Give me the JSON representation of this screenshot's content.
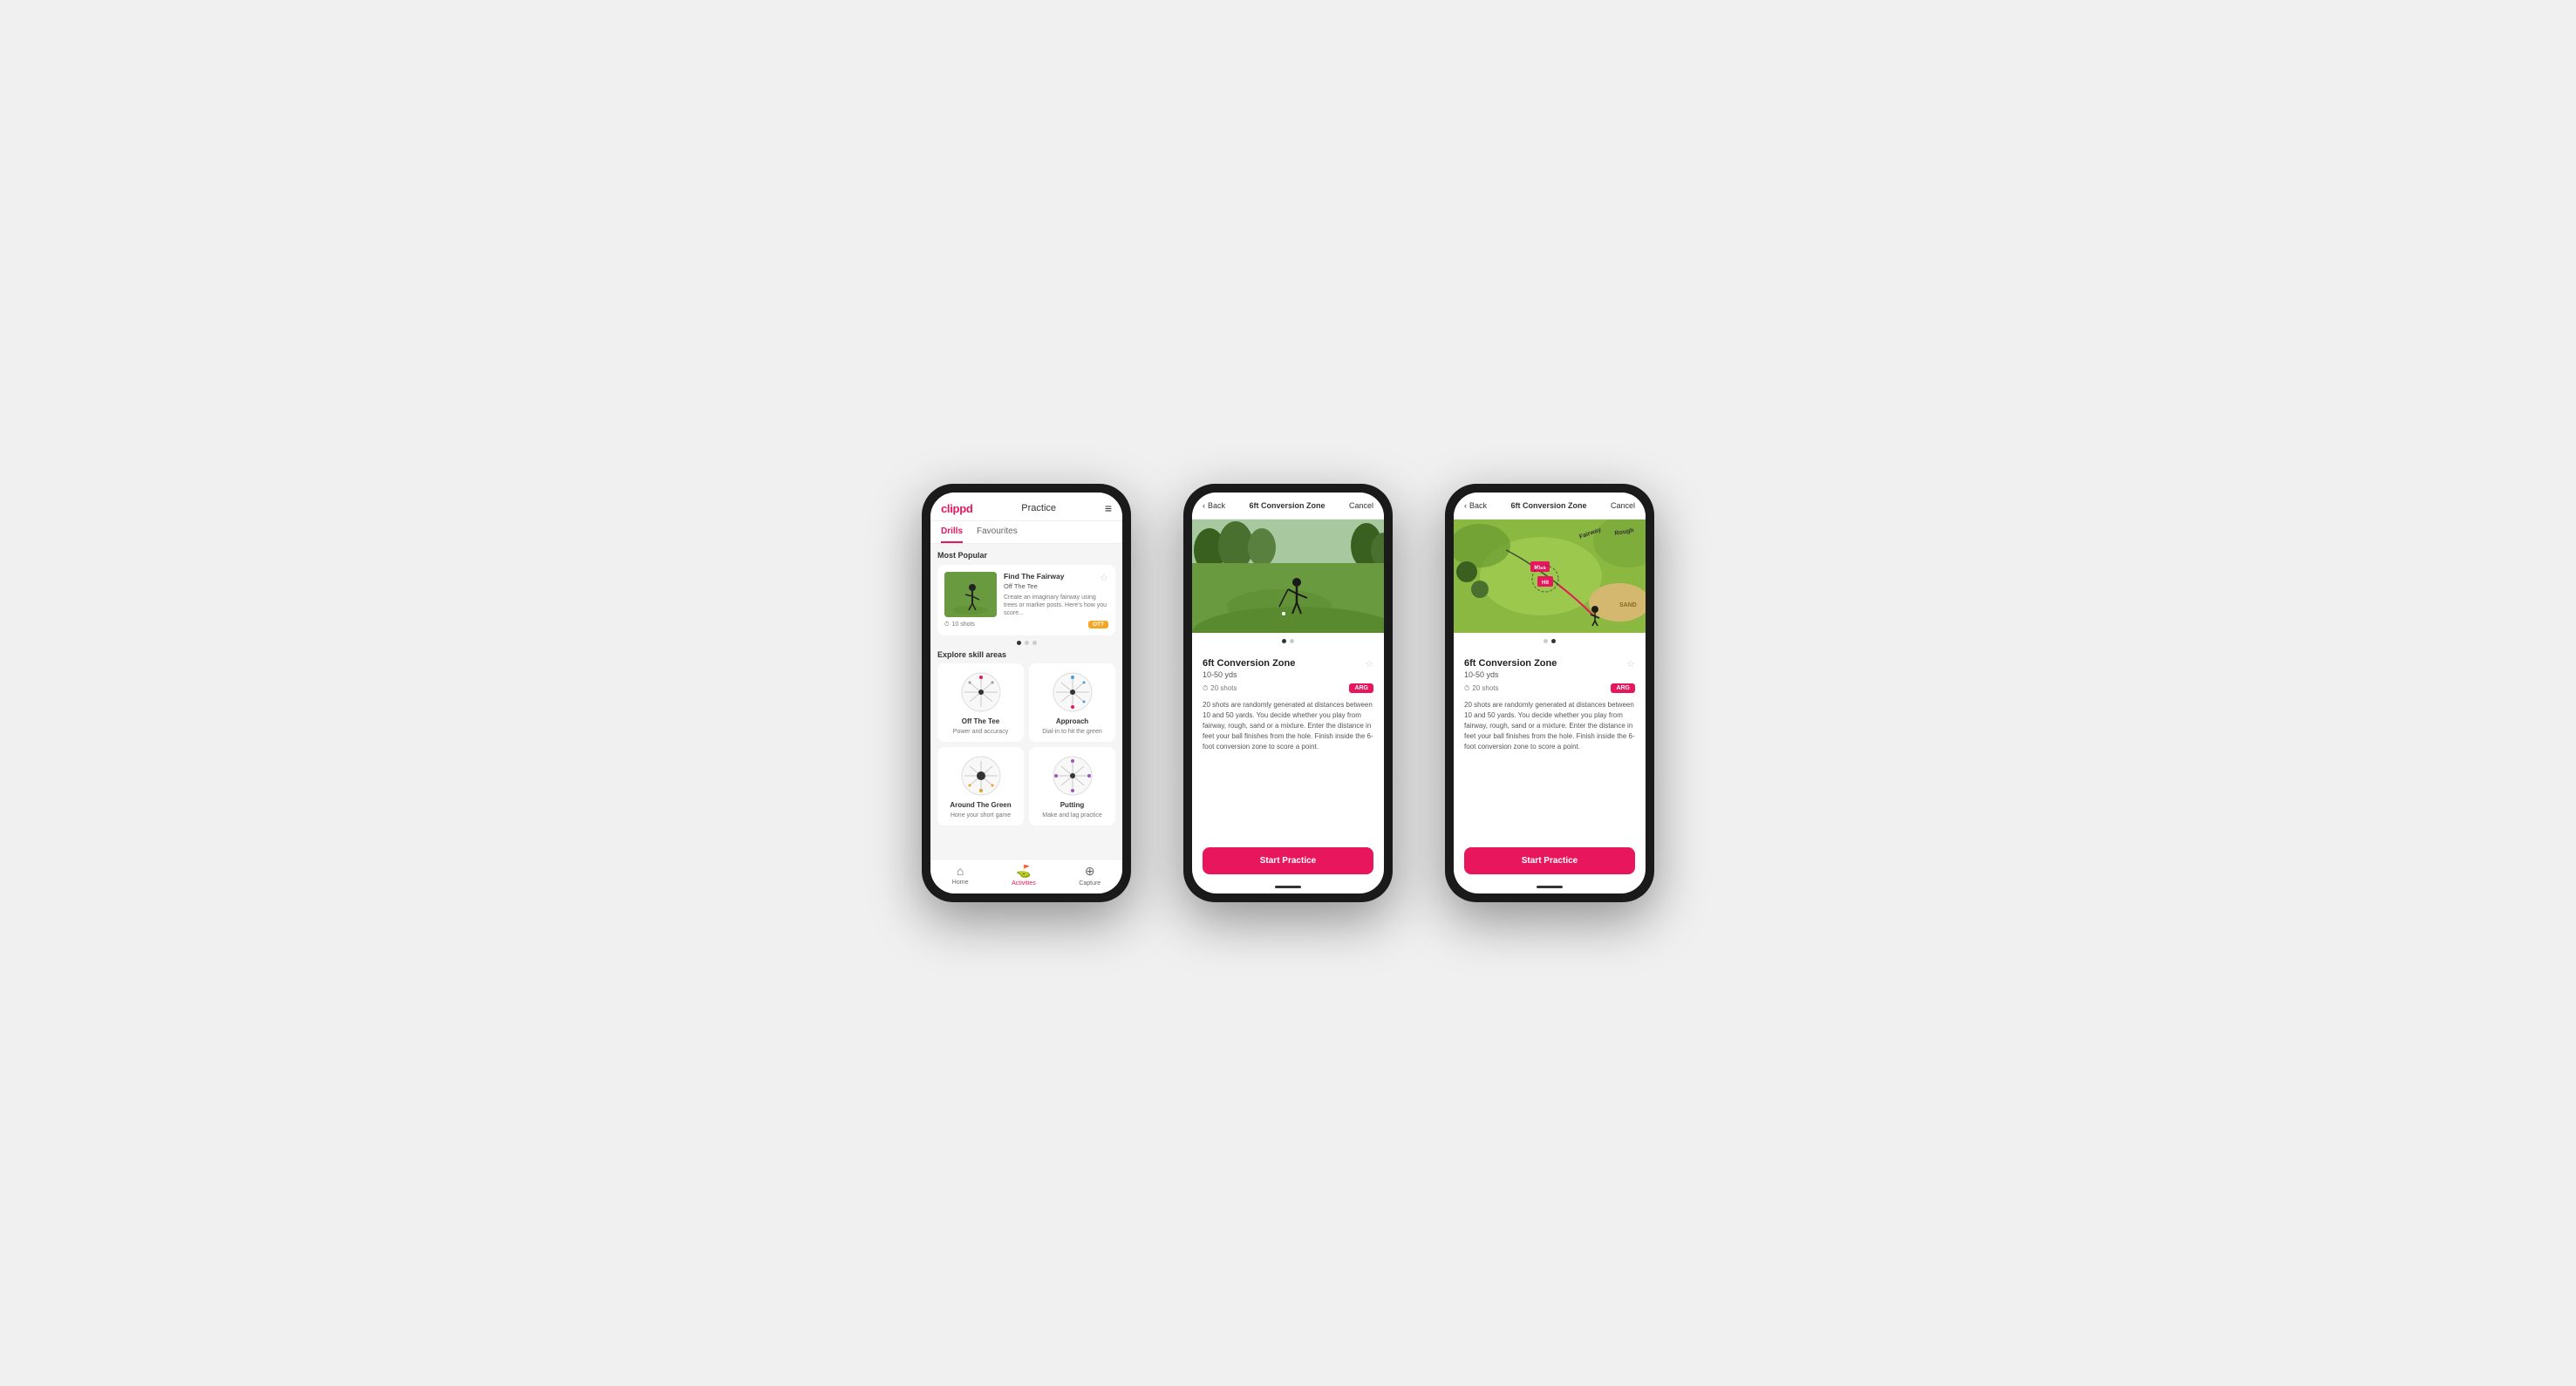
{
  "phone1": {
    "header": {
      "logo": "clippd",
      "title": "Practice",
      "menu_icon": "≡"
    },
    "tabs": [
      {
        "label": "Drills",
        "active": true
      },
      {
        "label": "Favourites",
        "active": false
      }
    ],
    "most_popular_label": "Most Popular",
    "featured_drill": {
      "title": "Find The Fairway",
      "subtitle": "Off The Tee",
      "description": "Create an imaginary fairway using trees or marker posts. Here's how you score...",
      "shots": "10 shots",
      "badge": "OTT"
    },
    "explore_label": "Explore skill areas",
    "skill_areas": [
      {
        "title": "Off The Tee",
        "sub": "Power and accuracy",
        "icon": "ott"
      },
      {
        "title": "Approach",
        "sub": "Dial-in to hit the green",
        "icon": "approach"
      },
      {
        "title": "Around The Green",
        "sub": "Hone your short game",
        "icon": "atg"
      },
      {
        "title": "Putting",
        "sub": "Make and lag practice",
        "icon": "putting"
      }
    ],
    "nav": [
      {
        "label": "Home",
        "icon": "⌂",
        "active": false
      },
      {
        "label": "Activities",
        "icon": "⛳",
        "active": true
      },
      {
        "label": "Capture",
        "icon": "⊕",
        "active": false
      }
    ]
  },
  "phone2": {
    "header": {
      "back": "Back",
      "title": "6ft Conversion Zone",
      "cancel": "Cancel"
    },
    "drill": {
      "title": "6ft Conversion Zone",
      "range": "10-50 yds",
      "shots": "20 shots",
      "badge": "ARG",
      "description": "20 shots are randomly generated at distances between 10 and 50 yards. You decide whether you play from fairway, rough, sand or a mixture. Enter the distance in feet your ball finishes from the hole. Finish inside the 6-foot conversion zone to score a point."
    },
    "start_button": "Start Practice"
  },
  "phone3": {
    "header": {
      "back": "Back",
      "title": "6ft Conversion Zone",
      "cancel": "Cancel"
    },
    "drill": {
      "title": "6ft Conversion Zone",
      "range": "10-50 yds",
      "shots": "20 shots",
      "badge": "ARG",
      "description": "20 shots are randomly generated at distances between 10 and 50 yards. You decide whether you play from fairway, rough, sand or a mixture. Enter the distance in feet your ball finishes from the hole. Finish inside the 6-foot conversion zone to score a point."
    },
    "start_button": "Start Practice",
    "map_labels": [
      "Fairway",
      "Rough",
      "Miss",
      "Hit",
      "Sand"
    ]
  }
}
